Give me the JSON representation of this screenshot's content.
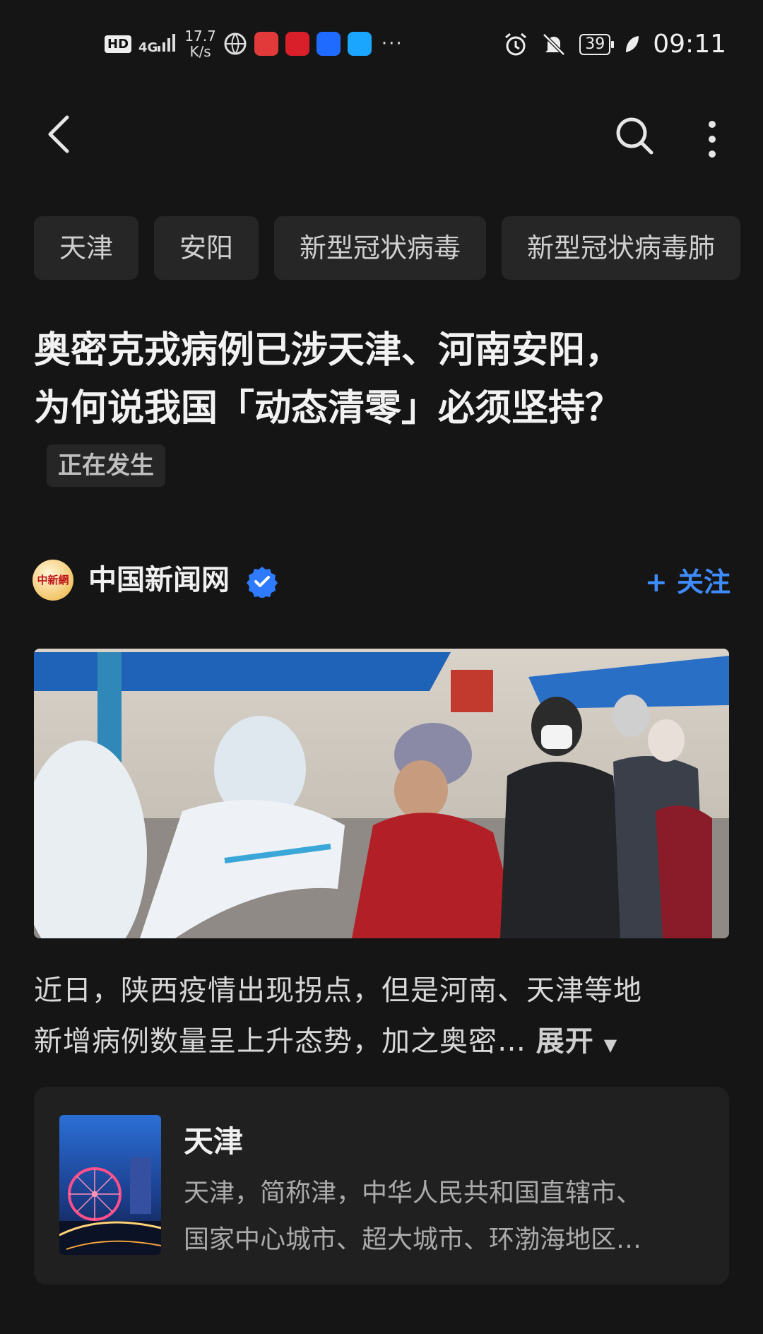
{
  "status_bar": {
    "hd_badge": "HD",
    "network": "4G",
    "speed_value": "17.7",
    "speed_unit": "K/s",
    "more": "···",
    "battery": "39",
    "time": "09:11"
  },
  "tags": [
    "天津",
    "安阳",
    "新型冠状病毒",
    "新型冠状病毒肺"
  ],
  "article": {
    "title_line1": "奥密克戎病例已涉天津、河南安阳，",
    "title_line2": "为何说我国「动态清零」必须坚持？",
    "live_badge": "正在发生",
    "summary_line1": "近日，陕西疫情出现拐点，但是河南、天津等地",
    "summary_line2": "新增病例数量呈上升态势，加之奥密…",
    "expand_label": "展开",
    "expand_caret": "▼"
  },
  "author": {
    "logo_text": "中新網",
    "name": "中国新闻网",
    "follow_label": "+ 关注"
  },
  "card": {
    "title": "天津",
    "desc_line1": "天津，简称津，中华人民共和国直辖市、",
    "desc_line2": "国家中心城市、超大城市、环渤海地区…"
  },
  "colors": {
    "background": "#151515",
    "accent": "#3f8cff",
    "tag_bg": "#262626",
    "card_bg": "#202020"
  },
  "icons": {
    "back": "chevron-left-icon",
    "search": "search-icon",
    "more": "more-vertical-icon",
    "verified": "verified-badge-icon"
  }
}
